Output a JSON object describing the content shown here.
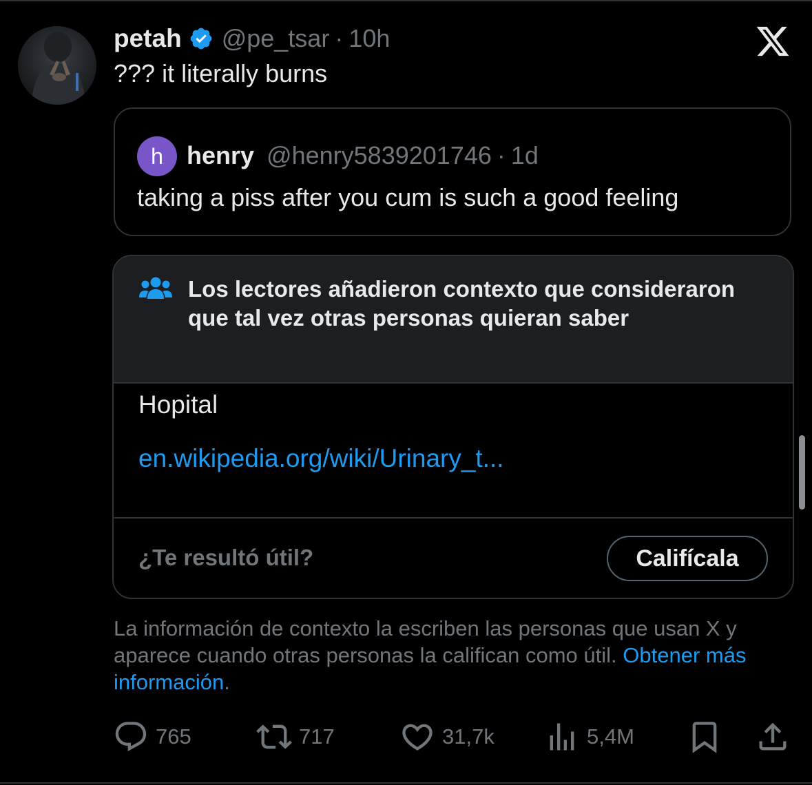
{
  "tweet": {
    "author_name": "petah",
    "handle": "@pe_tsar",
    "separator": "·",
    "time": "10h",
    "text": "??? it literally burns",
    "verified": true
  },
  "quote": {
    "avatar_letter": "h",
    "avatar_color": "#7856c9",
    "author_name": "henry",
    "handle": "@henry5839201746",
    "separator": "·",
    "time": "1d",
    "text": "taking a piss after you cum is such a good feeling"
  },
  "community_note": {
    "title": "Los lectores añadieron contexto que consideraron que tal vez otras personas quieran saber",
    "body": "Hopital",
    "link": "en.wikipedia.org/wiki/Urinary_t...",
    "rate_question": "¿Te resultó útil?",
    "rate_button": "Califícala"
  },
  "disclaimer": {
    "text": "La información de contexto la escriben las personas que usan X y aparece cuando otras personas la califican como útil. ",
    "link": "Obtener más información",
    "end": "."
  },
  "actions": {
    "replies": "765",
    "reposts": "717",
    "likes": "31,7k",
    "views": "5,4M"
  },
  "icons": {
    "brand": "x-logo-icon",
    "verified": "verified-badge-icon",
    "note": "people-icon",
    "reply": "reply-icon",
    "repost": "repost-icon",
    "like": "heart-icon",
    "views": "views-icon",
    "bookmark": "bookmark-icon",
    "share": "share-icon"
  },
  "colors": {
    "background": "#000000",
    "text": "#e7e9ea",
    "muted": "#71767b",
    "accent": "#1d9bf0",
    "border": "#2f3336",
    "note_header": "#1c1e21"
  }
}
